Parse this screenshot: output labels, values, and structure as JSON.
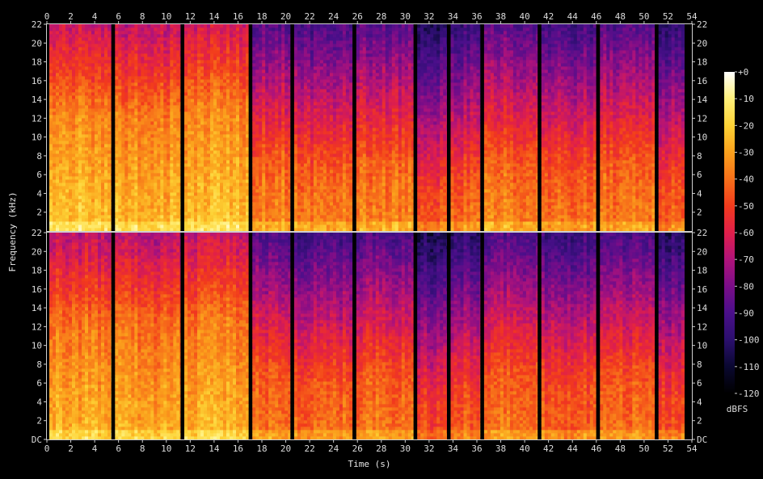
{
  "chart_data": {
    "type": "heatmap",
    "title": "",
    "xlabel": "Time (s)",
    "ylabel": "Frequency (kHz)",
    "xlim": [
      0,
      54
    ],
    "ylim_khz": [
      0,
      22
    ],
    "x_ticks": [
      "0",
      "2",
      "4",
      "6",
      "8",
      "10",
      "12",
      "14",
      "16",
      "18",
      "20",
      "22",
      "24",
      "26",
      "28",
      "30",
      "32",
      "34",
      "36",
      "38",
      "40",
      "42",
      "44",
      "46",
      "48",
      "50",
      "52",
      "54"
    ],
    "y_ticks": [
      "DC",
      "2",
      "4",
      "6",
      "8",
      "10",
      "12",
      "14",
      "16",
      "18",
      "20",
      "22"
    ],
    "channels": 2,
    "colorbar": {
      "label": "dBFS",
      "range_db": [
        -120,
        0
      ],
      "ticks": [
        "+0",
        "-10",
        "-20",
        "-30",
        "-40",
        "-50",
        "-60",
        "-70",
        "-80",
        "-90",
        "-100",
        "-110",
        "-120"
      ],
      "colors": [
        "#000000",
        "#0a0830",
        "#2b0f6e",
        "#4a0f8a",
        "#7a0d88",
        "#b0137a",
        "#e01f4a",
        "#f23a1c",
        "#f7701a",
        "#fba11c",
        "#fdd235",
        "#fff07a",
        "#ffffff"
      ]
    },
    "silence_gaps_s": [
      5.5,
      11.3,
      17.0,
      20.5,
      25.7,
      30.8,
      33.6,
      36.4,
      41.2,
      46.1,
      51.0,
      53.5
    ],
    "segments": [
      {
        "start": 0.0,
        "end": 5.5,
        "loudness_db": -40,
        "brightness_khz": 12
      },
      {
        "start": 5.5,
        "end": 11.3,
        "loudness_db": -42,
        "brightness_khz": 12
      },
      {
        "start": 11.3,
        "end": 17.0,
        "loudness_db": -40,
        "brightness_khz": 13
      },
      {
        "start": 17.0,
        "end": 20.5,
        "loudness_db": -52,
        "brightness_khz": 7
      },
      {
        "start": 20.5,
        "end": 25.7,
        "loudness_db": -54,
        "brightness_khz": 6
      },
      {
        "start": 25.7,
        "end": 30.8,
        "loudness_db": -52,
        "brightness_khz": 7
      },
      {
        "start": 30.8,
        "end": 33.6,
        "loudness_db": -62,
        "brightness_khz": 4
      },
      {
        "start": 33.6,
        "end": 36.4,
        "loudness_db": -58,
        "brightness_khz": 5
      },
      {
        "start": 36.4,
        "end": 41.2,
        "loudness_db": -52,
        "brightness_khz": 7
      },
      {
        "start": 41.2,
        "end": 46.1,
        "loudness_db": -56,
        "brightness_khz": 6
      },
      {
        "start": 46.1,
        "end": 51.0,
        "loudness_db": -54,
        "brightness_khz": 7
      },
      {
        "start": 51.0,
        "end": 53.5,
        "loudness_db": -60,
        "brightness_khz": 5
      }
    ]
  }
}
